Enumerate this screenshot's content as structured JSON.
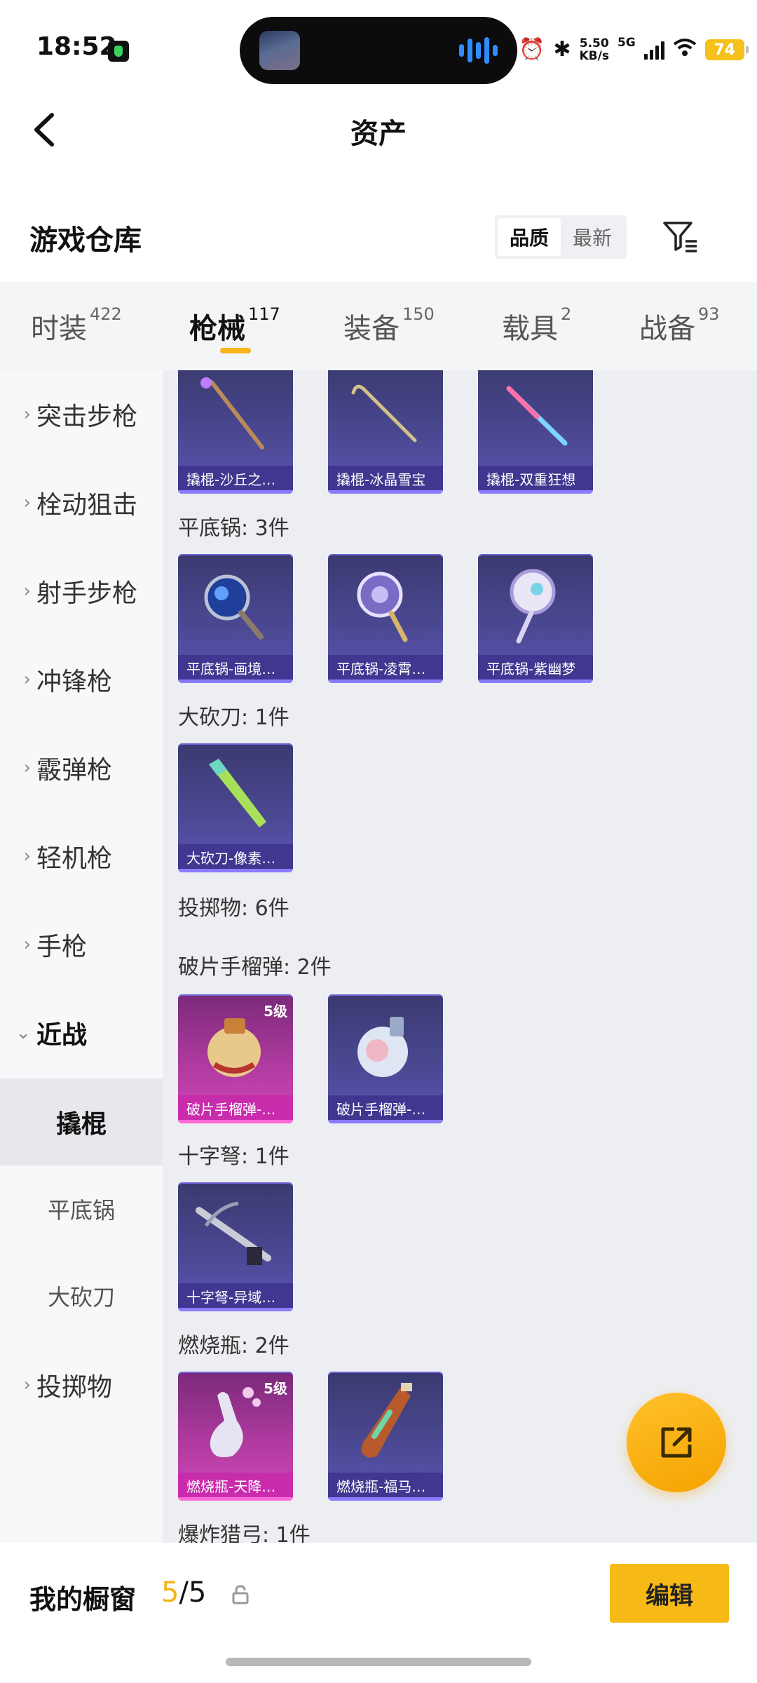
{
  "status_bar": {
    "time": "18:52",
    "speed_value": "5.50",
    "speed_unit": "KB/s",
    "network": "5G",
    "battery": "74"
  },
  "header": {
    "title": "资产"
  },
  "warehouse": {
    "title": "游戏仓库",
    "sort_options": [
      "品质",
      "最新"
    ],
    "active_sort": "品质"
  },
  "tabs": [
    {
      "label": "时装",
      "count": "422"
    },
    {
      "label": "枪械",
      "count": "117"
    },
    {
      "label": "装备",
      "count": "150"
    },
    {
      "label": "载具",
      "count": "2"
    },
    {
      "label": "战备",
      "count": "93"
    }
  ],
  "active_tab": "枪械",
  "sidebar": {
    "categories": [
      "突击步枪",
      "栓动狙击",
      "射手步枪",
      "冲锋枪",
      "霰弹枪",
      "轻机枪",
      "手枪",
      "近战",
      "投掷物"
    ],
    "subcategories": [
      "撬棍",
      "平底锅",
      "大砍刀"
    ],
    "active_sub": "撬棍"
  },
  "content": {
    "crowbar_items": [
      "撬棍-沙丘之…",
      "撬棍-冰晶雪宝",
      "撬棍-双重狂想"
    ],
    "groups": [
      {
        "label": "平底锅: 3件",
        "items": [
          "平底锅-画境…",
          "平底锅-凌霄…",
          "平底锅-紫幽梦"
        ]
      },
      {
        "label": "大砍刀: 1件",
        "items": [
          "大砍刀-像素…"
        ]
      },
      {
        "label": "投掷物: 6件",
        "items": []
      },
      {
        "label": "破片手榴弹: 2件",
        "items": [
          "破片手榴弹-…",
          "破片手榴弹-…"
        ]
      },
      {
        "label": "十字弩: 1件",
        "items": [
          "十字弩-异域…"
        ]
      },
      {
        "label": "燃烧瓶: 2件",
        "items": [
          "燃烧瓶-天降…",
          "燃烧瓶-福马…"
        ]
      },
      {
        "label": "爆炸猎弓: 1件",
        "items": []
      }
    ],
    "level_badge": "5级"
  },
  "bottom": {
    "showcase_label": "我的橱窗",
    "showcase_used": "5",
    "showcase_total": "/5",
    "edit_label": "编辑"
  },
  "colors": {
    "accent": "#f7b916",
    "card_purple": "#4b4892",
    "card_gold": "#c03aa8"
  },
  "icons": {
    "back": "chevron-left-icon",
    "filter": "filter-icon",
    "fab": "share-external-icon",
    "lock": "lock-icon"
  }
}
